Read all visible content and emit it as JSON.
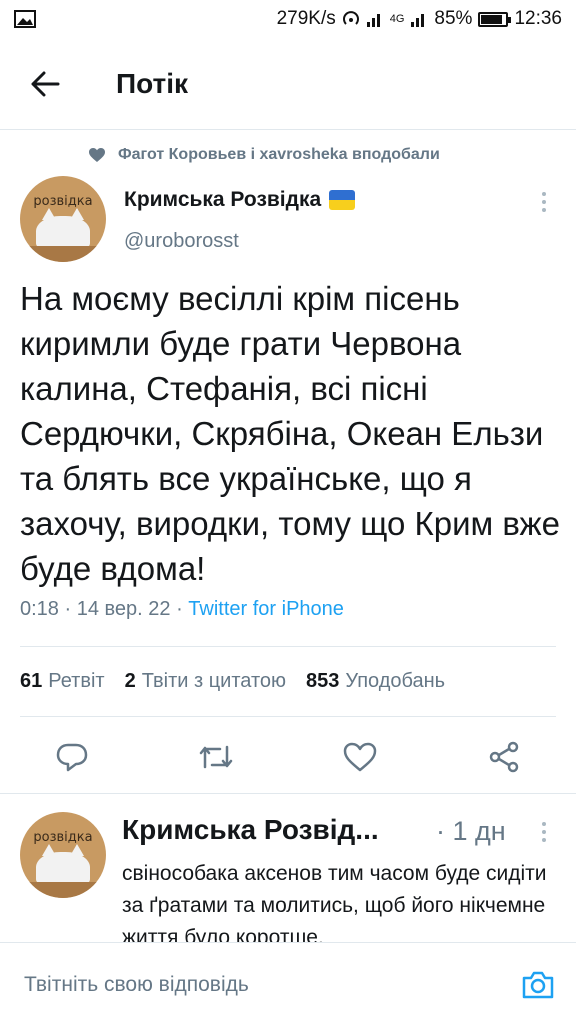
{
  "status_bar": {
    "speed": "279K/s",
    "network": "4G",
    "battery": "85%",
    "time": "12:36"
  },
  "header": {
    "back_icon": "arrow-left-icon",
    "title": "Потік"
  },
  "liked_by": {
    "icon": "heart-icon",
    "text": "Фагот Коровьев і xavrosheka вподобали"
  },
  "tweet": {
    "avatar_text": "розвідка",
    "author_name": "Кримська Розвідка",
    "author_flag_colors": [
      "#2f6fd1",
      "#f7cf1d"
    ],
    "handle": "@uroborosst",
    "text": "На моєму весіллі крім пісень киримли буде грати Червона калина, Стефанія, всі пісні Сердючки, Скрябіна, Океан Ельзи та блять все українське, що я захочу, виродки, тому що Крим вже буде вдома!",
    "timestamp": "0:18 · 14 вер. 22 · ",
    "source": "Twitter for iPhone",
    "stats": {
      "retweets_count": "61",
      "retweets_label": "Ретвіт",
      "quotes_count": "2",
      "quotes_label": "Твіти з цитатою",
      "likes_count": "853",
      "likes_label": "Уподобань"
    },
    "actions": [
      "reply-icon",
      "retweet-icon",
      "like-icon",
      "share-icon"
    ]
  },
  "reply": {
    "avatar_text": "розвідка",
    "author_name": "Кримська Розвід...",
    "time": "· 1 дн",
    "text": "свінособака аксенов тим часом буде сидіти за ґратами та молитись, щоб його нікчемне життя було коротше."
  },
  "compose": {
    "placeholder": "Твітніть свою відповідь",
    "camera_icon": "camera-icon"
  },
  "colors": {
    "accent": "#1da1f2",
    "secondary_text": "#657786",
    "primary_text": "#14171a",
    "divider": "#e1e8ed"
  }
}
